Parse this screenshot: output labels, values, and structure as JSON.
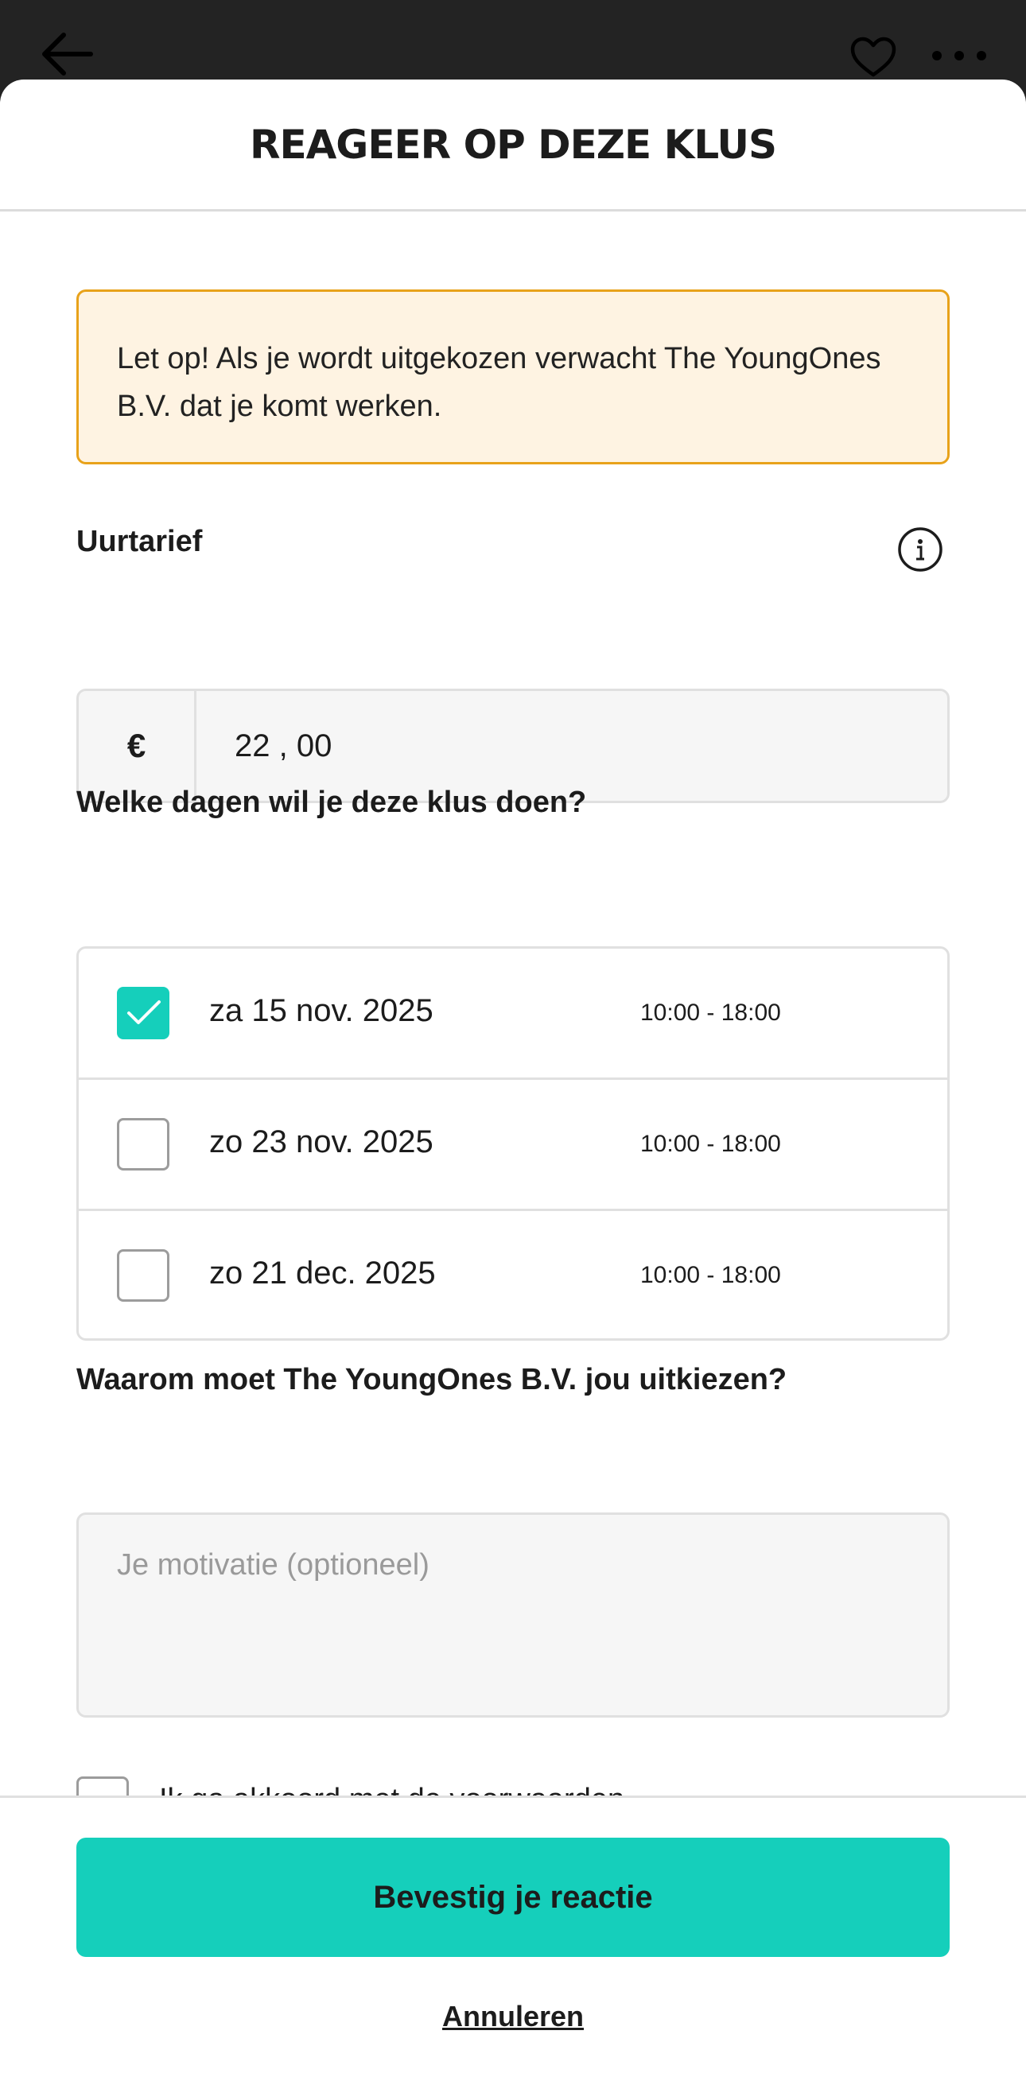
{
  "topbar": {
    "back_icon": "arrow-left-icon",
    "favorite_icon": "heart-icon",
    "more_icon": "more-horizontal-icon"
  },
  "sheet": {
    "title": "REAGEER OP DEZE KLUS"
  },
  "warning": {
    "text": "Let op! Als je wordt uitgekozen verwacht The YoungOnes B.V. dat je komt werken.",
    "colors": {
      "background": "#fef3e2",
      "border": "#e8a21a"
    }
  },
  "rate": {
    "label": "Uurtarief",
    "info_icon": "info-icon",
    "currency": "€",
    "value": "22 , 00"
  },
  "days": {
    "label": "Welke dagen wil je deze klus doen?",
    "items": [
      {
        "date": "za 15 nov. 2025",
        "time": "10:00 - 18:00",
        "checked": true
      },
      {
        "date": "zo 23 nov. 2025",
        "time": "10:00 - 18:00",
        "checked": false
      },
      {
        "date": "zo 21 dec. 2025",
        "time": "10:00 - 18:00",
        "checked": false
      }
    ]
  },
  "motivation": {
    "label": "Waarom moet The YoungOnes B.V. jou uitkiezen?",
    "placeholder": "Je motivatie (optioneel)",
    "value": ""
  },
  "terms": {
    "text": "Ik ga akkoord met de voorwaarden",
    "checked": false
  },
  "footer": {
    "confirm_label": "Bevestig je reactie",
    "cancel_label": "Annuleren"
  },
  "colors": {
    "accent": "#15cfbb",
    "topbar": "#232323",
    "text": "#1c1c1c"
  }
}
